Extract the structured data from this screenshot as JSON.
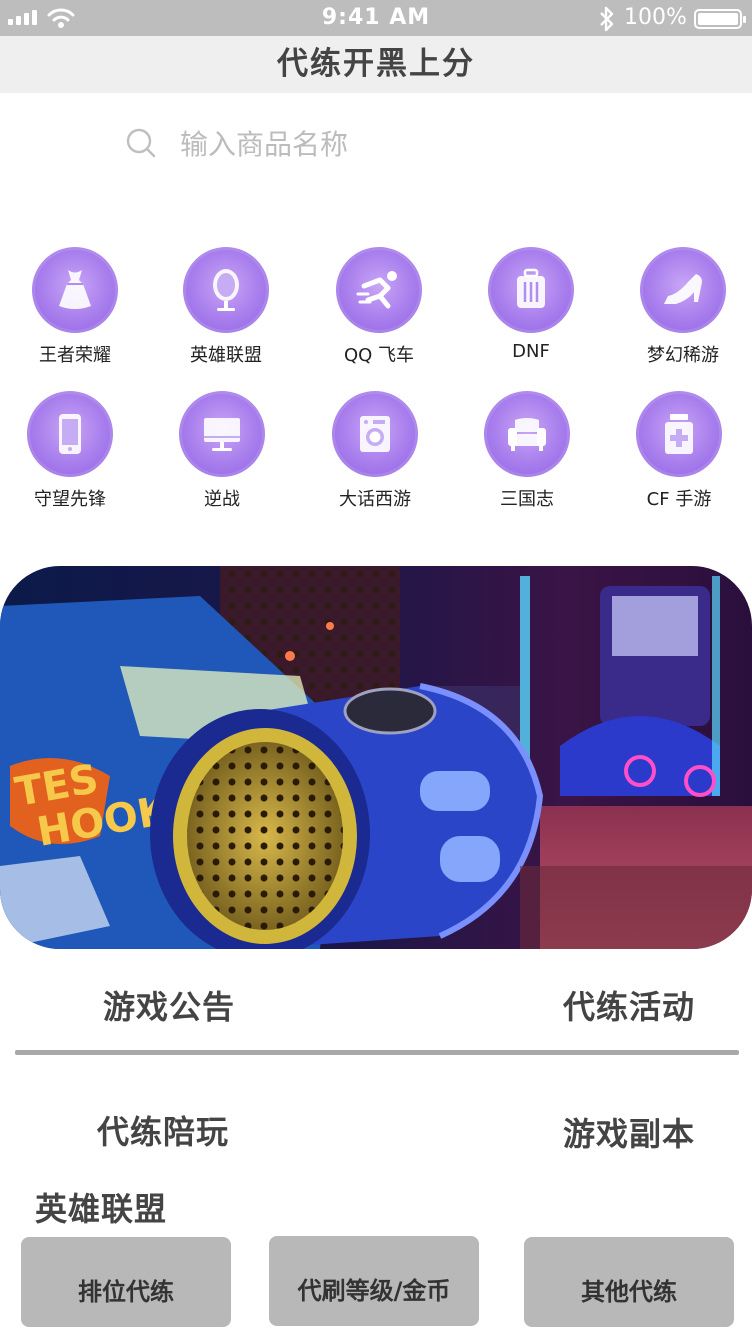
{
  "status_bar": {
    "time": "9:41 AM",
    "battery": "100%"
  },
  "nav": {
    "title": "代练开黑上分"
  },
  "search": {
    "placeholder": "输入商品名称",
    "value": ""
  },
  "categories": [
    {
      "label": "王者荣耀",
      "icon": "dress-icon"
    },
    {
      "label": "英雄联盟",
      "icon": "mirror-icon"
    },
    {
      "label": "QQ 飞车",
      "icon": "running-icon"
    },
    {
      "label": "DNF",
      "icon": "luggage-icon"
    },
    {
      "label": "梦幻稀游",
      "icon": "high-heel-icon"
    },
    {
      "label": "守望先锋",
      "icon": "phone-icon"
    },
    {
      "label": "逆战",
      "icon": "monitor-icon"
    },
    {
      "label": "大话西游",
      "icon": "washing-machine-icon"
    },
    {
      "label": "三国志",
      "icon": "sofa-icon"
    },
    {
      "label": "CF 手游",
      "icon": "medicine-icon"
    }
  ],
  "sections": {
    "announcement": "游戏公告",
    "activity": "代练活动",
    "companion": "代练陪玩",
    "dungeon": "游戏副本",
    "game_title": "英雄联盟"
  },
  "buttons": {
    "rank": "排位代练",
    "level": "代刷等级/金币",
    "other": "其他代练"
  },
  "colors": {
    "status_bar": "#bdbdbd",
    "nav_bar": "#efefef",
    "icon_purple": "#a77cec",
    "button_gray": "#b8b8b8"
  }
}
